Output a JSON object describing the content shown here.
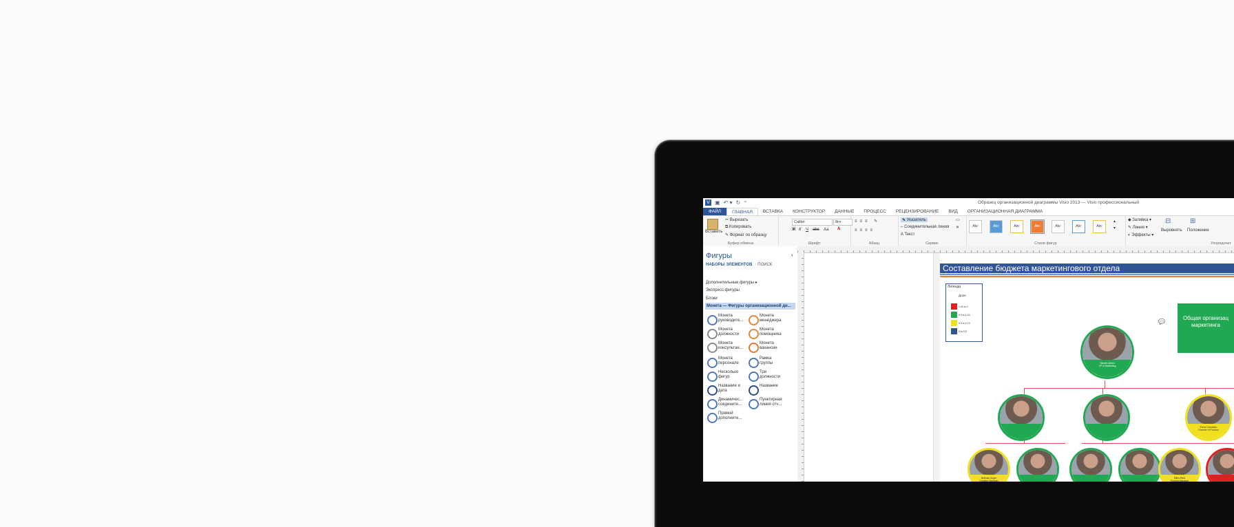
{
  "window": {
    "title": "Образец организационной диаграммы Visio 2013 — Visio профессиональный"
  },
  "tabs": [
    "ФАЙЛ",
    "ГЛАВНАЯ",
    "ВСТАВКА",
    "КОНСТРУКТОР",
    "ДАННЫЕ",
    "ПРОЦЕСС",
    "РЕЦЕНЗИРОВАНИЕ",
    "ВИД",
    "ОРГАНИЗАЦИОННАЯ ДИАГРАММА"
  ],
  "ribbon": {
    "clipboard": {
      "paste": "Вставить",
      "cut": "Вырезать",
      "copy": "Копировать",
      "format_painter": "Формат по образцу",
      "label": "Буфер обмена"
    },
    "font": {
      "name": "Calibri",
      "size": "8пт",
      "bold": "Ж",
      "italic": "К",
      "underline": "Ч",
      "strike": "abc",
      "case": "Аа",
      "label": "Шрифт"
    },
    "paragraph": {
      "label": "Абзац"
    },
    "tools": {
      "pointer": "Указатель",
      "connector": "Соединительная линия",
      "text": "Текст",
      "label": "Сервис"
    },
    "styles": {
      "sample": "Abc",
      "label": "Стили фигур",
      "fill": "Заливка",
      "line": "Линия",
      "effects": "Эффекты"
    },
    "arrange": {
      "align": "Выровнять",
      "position": "Положение",
      "label": "Упорядочит"
    }
  },
  "shapes_pane": {
    "title": "Фигуры",
    "tab_stencils": "НАБОРЫ ЭЛЕМЕНТОВ",
    "tab_search": "ПОИСК",
    "more_shapes": "Дополнительные фигуры",
    "quick_shapes": "Экспресс-фигуры",
    "blocks": "Блоки",
    "selected_stencil": "Монета — Фигуры организационной ди...",
    "items": [
      {
        "label1": "Монета",
        "label2": "руководите...",
        "color": "#4e79b8"
      },
      {
        "label1": "Монета",
        "label2": "менеджера",
        "color": "#e0883a"
      },
      {
        "label1": "Монета",
        "label2": "должности",
        "color": "#8a8a8a"
      },
      {
        "label1": "Монета",
        "label2": "помощника",
        "color": "#e0883a"
      },
      {
        "label1": "Монета",
        "label2": "консультан...",
        "color": "#8a8a8a"
      },
      {
        "label1": "Монета",
        "label2": "вакансии",
        "color": "#e07a2e"
      },
      {
        "label1": "Монета",
        "label2": "персонале",
        "color": "#4e79b8"
      },
      {
        "label1": "Рамка",
        "label2": "группы",
        "color": "#4e79b8"
      },
      {
        "label1": "Несколько",
        "label2": "фигур",
        "color": "#4e79b8"
      },
      {
        "label1": "Три",
        "label2": "должности",
        "color": "#4e79b8"
      },
      {
        "label1": "Название и",
        "label2": "дата",
        "color": "#2b4f84"
      },
      {
        "label1": "Название",
        "label2": "",
        "color": "#2b4f84"
      },
      {
        "label1": "Динамичес...",
        "label2": "соедините...",
        "color": "#4e79b8"
      },
      {
        "label1": "Пунктирная",
        "label2": "линия отч...",
        "color": "#4e79b8"
      },
      {
        "label1": "Прямой",
        "label2": "дополните...",
        "color": "#4e79b8"
      }
    ]
  },
  "diagram": {
    "title": "Составление бюджета маркетингового отдела",
    "legend_title": "Легенда",
    "legend_subtitle": "Доля",
    "legend": [
      {
        "label": "1.00 to 2",
        "color": "#e02020"
      },
      {
        "label": "0.9 to 1.00",
        "color": "#21a852"
      },
      {
        "label": "0.5 to 0.79",
        "color": "#f0e020"
      },
      {
        "label": "0 to 0.5",
        "color": "#2f5597"
      }
    ],
    "green_card": {
      "line1": "Общая организац",
      "line2": "маркетинга"
    },
    "top_node": {
      "name": "Steven Alford",
      "role": "VP of Marketing"
    },
    "mid_nodes": [
      {
        "name": "",
        "role": ""
      },
      {
        "name": "",
        "role": ""
      },
      {
        "name": "Fiona Camacho",
        "role": "Director of Product"
      }
    ],
    "bottom_nodes": [
      {
        "name": "Belinda Ongre",
        "role": "Creative Manager"
      },
      {
        "name": "",
        "role": ""
      },
      {
        "name": "",
        "role": ""
      },
      {
        "name": "",
        "role": ""
      },
      {
        "name": "Miles Reid",
        "role": "Product Manager"
      },
      {
        "name": "",
        "role": ""
      }
    ]
  }
}
